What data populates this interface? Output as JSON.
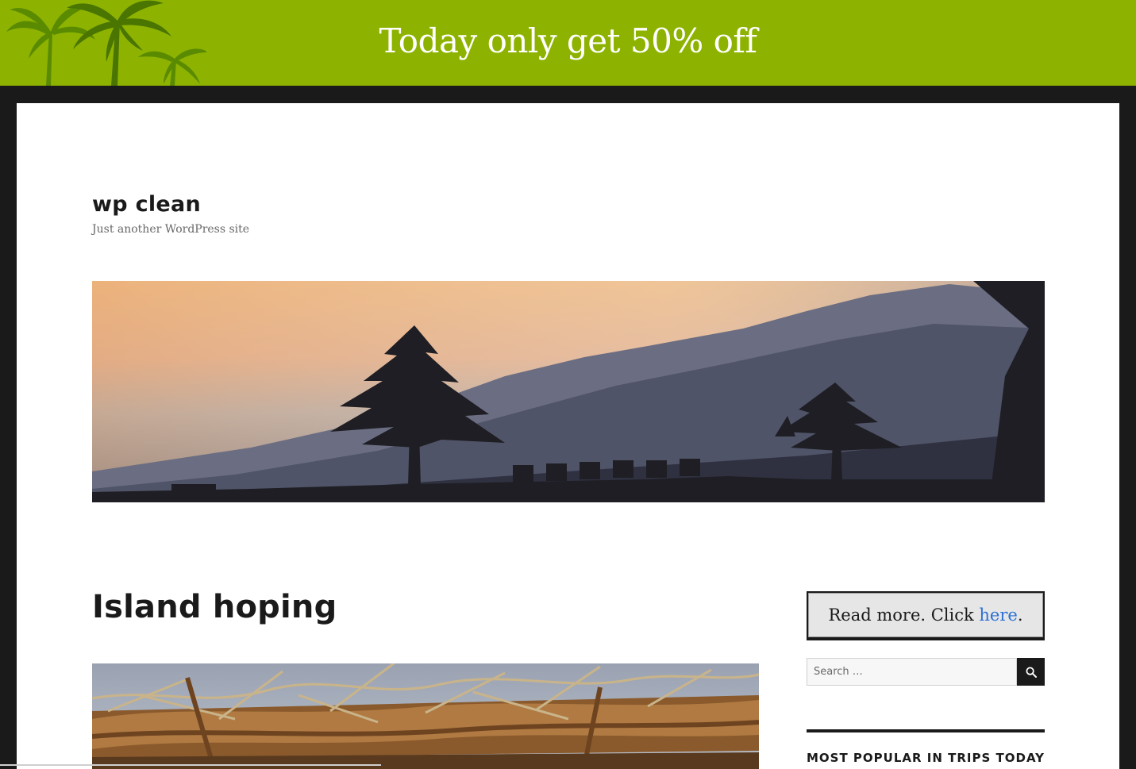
{
  "promo": {
    "text": "Today only get 50% off"
  },
  "site": {
    "title": "wp clean",
    "description": "Just another WordPress site"
  },
  "post": {
    "title": "Island hoping"
  },
  "sidebar": {
    "readmore": {
      "text": "Read more. Click ",
      "link": "here",
      "suffix": "."
    },
    "search": {
      "placeholder": "Search …"
    },
    "popular": {
      "title": "MOST POPULAR IN TRIPS TODAY"
    }
  },
  "colors": {
    "promo_bg": "#8db300",
    "frame": "#1a1a1a",
    "link": "#2b6fd6"
  },
  "icons": {
    "search_button": "search-icon",
    "promo_decoration": "palm-trees-icon"
  }
}
